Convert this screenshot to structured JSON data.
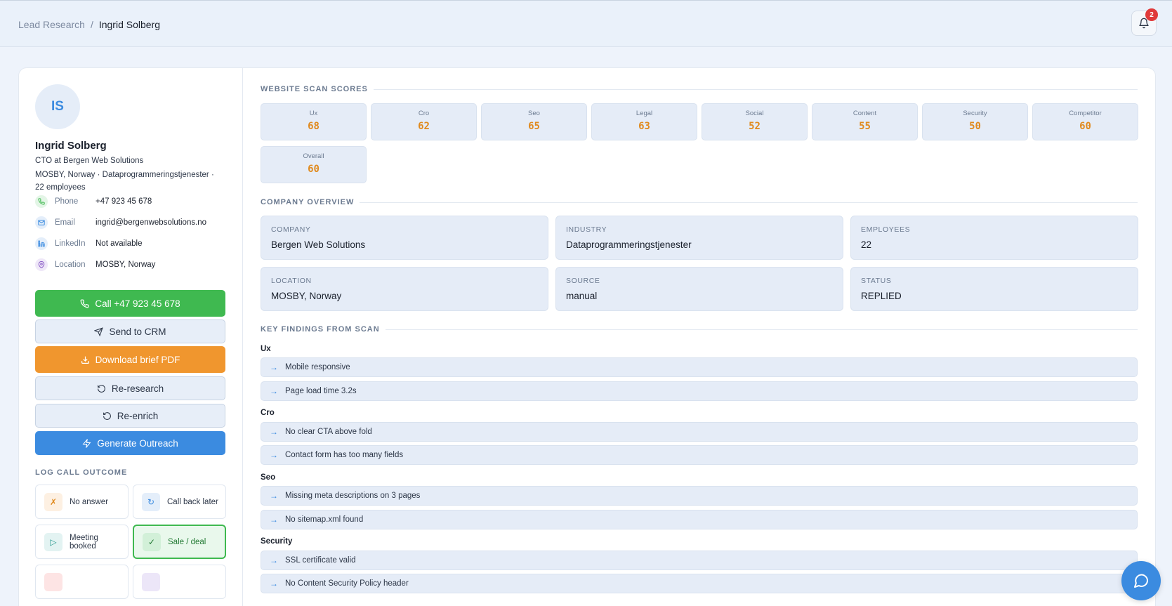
{
  "breadcrumb": {
    "parent": "Lead Research",
    "separator": "/",
    "current": "Ingrid Solberg"
  },
  "notifications": {
    "count": "2",
    "icon": "bell-icon"
  },
  "lead": {
    "initials": "IS",
    "name": "Ingrid Solberg",
    "title": "CTO at Bergen Web Solutions",
    "meta": "MOSBY, Norway · Dataprogrammeringstjenester · 22 employees",
    "contacts": [
      {
        "label": "Phone",
        "value": "+47 923 45 678",
        "icon": "phone-icon"
      },
      {
        "label": "Email",
        "value": "ingrid@bergenwebsolutions.no",
        "icon": "mail-icon"
      },
      {
        "label": "LinkedIn",
        "value": "Not available",
        "icon": "linkedin-icon"
      },
      {
        "label": "Location",
        "value": "MOSBY, Norway",
        "icon": "location-icon"
      }
    ]
  },
  "actions": {
    "call": "Call +47 923 45 678",
    "send_crm": "Send to CRM",
    "download_pdf": "Download brief PDF",
    "re_research": "Re-research",
    "re_enrich": "Re-enrich",
    "generate_outreach": "Generate Outreach"
  },
  "call_outcome": {
    "title": "LOG CALL OUTCOME",
    "options": [
      {
        "label": "No answer",
        "icon": "✗",
        "selected": false
      },
      {
        "label": "Call back later",
        "icon": "↻",
        "selected": false
      },
      {
        "label": "Meeting booked",
        "icon": "▷",
        "selected": false
      },
      {
        "label": "Sale / deal",
        "icon": "✓",
        "selected": true
      }
    ]
  },
  "scan_scores": {
    "title": "WEBSITE SCAN SCORES",
    "items": [
      {
        "label": "Ux",
        "value": "68"
      },
      {
        "label": "Cro",
        "value": "62"
      },
      {
        "label": "Seo",
        "value": "65"
      },
      {
        "label": "Legal",
        "value": "63"
      },
      {
        "label": "Social",
        "value": "52"
      },
      {
        "label": "Content",
        "value": "55"
      },
      {
        "label": "Security",
        "value": "50"
      },
      {
        "label": "Competitor",
        "value": "60"
      },
      {
        "label": "Overall",
        "value": "60"
      }
    ]
  },
  "company_overview": {
    "title": "COMPANY OVERVIEW",
    "fields": [
      {
        "label": "COMPANY",
        "value": "Bergen Web Solutions"
      },
      {
        "label": "INDUSTRY",
        "value": "Dataprogrammeringstjenester"
      },
      {
        "label": "EMPLOYEES",
        "value": "22"
      },
      {
        "label": "LOCATION",
        "value": "MOSBY, Norway"
      },
      {
        "label": "SOURCE",
        "value": "manual"
      },
      {
        "label": "STATUS",
        "value": "REPLIED"
      }
    ]
  },
  "key_findings": {
    "title": "KEY FINDINGS FROM SCAN",
    "groups": [
      {
        "name": "Ux",
        "items": [
          "Mobile responsive",
          "Page load time 3.2s"
        ]
      },
      {
        "name": "Cro",
        "items": [
          "No clear CTA above fold",
          "Contact form has too many fields"
        ]
      },
      {
        "name": "Seo",
        "items": [
          "Missing meta descriptions on 3 pages",
          "No sitemap.xml found"
        ]
      },
      {
        "name": "Security",
        "items": [
          "SSL certificate valid",
          "No Content Security Policy header"
        ]
      }
    ],
    "arrow": "→"
  },
  "colors": {
    "accent": "#3b8be0",
    "success": "#3fb950",
    "warning": "#f0962e",
    "score": "#e08a1e"
  }
}
